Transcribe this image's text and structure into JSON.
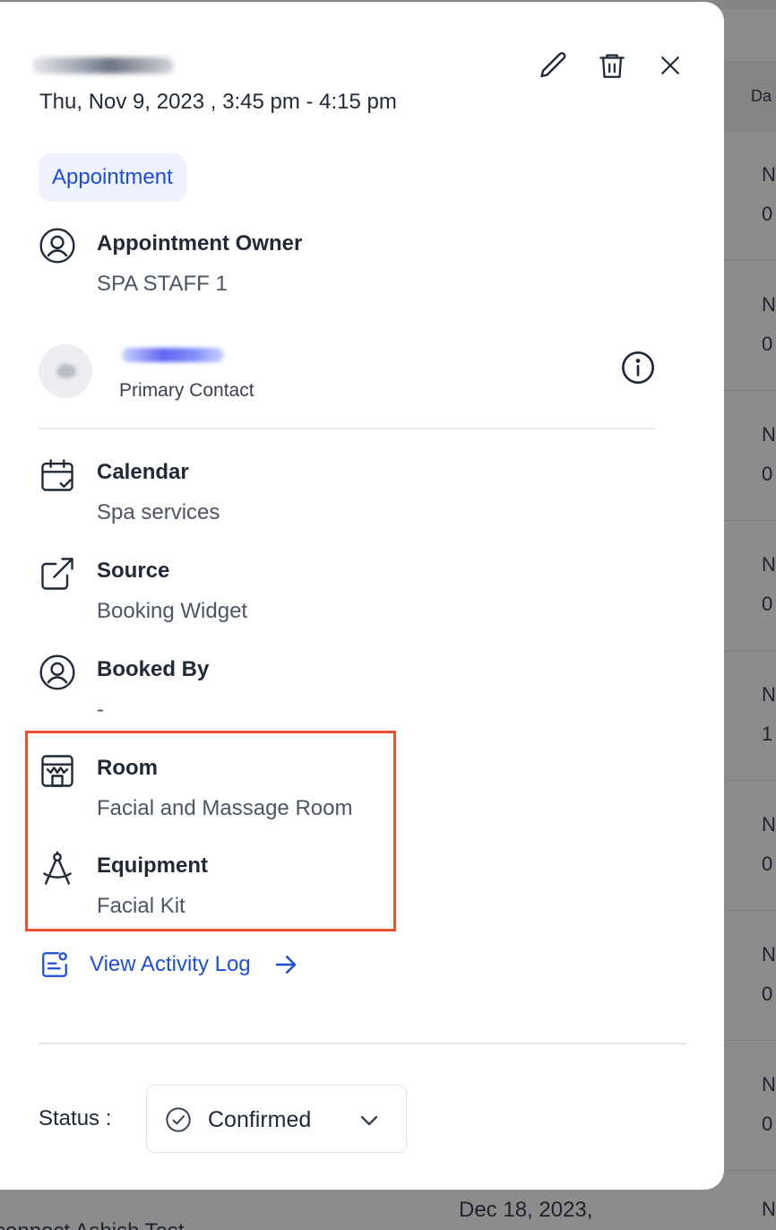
{
  "background_table": {
    "header": "Da",
    "rows": [
      {
        "l1": "N",
        "l2": "0"
      },
      {
        "l1": "N",
        "l2": "0"
      },
      {
        "l1": "N",
        "l2": "0"
      },
      {
        "l1": "N",
        "l2": "0"
      },
      {
        "l1": "N",
        "l2": "1"
      },
      {
        "l1": "N",
        "l2": "0"
      },
      {
        "l1": "N",
        "l2": "0"
      },
      {
        "l1": "N",
        "l2": "0"
      }
    ],
    "bottom_date": "Dec 18, 2023,",
    "bottom_name": "connect Ashish Test",
    "bottom_n": "N"
  },
  "appointment": {
    "datetime": "Thu, Nov 9, 2023 , 3:45 pm - 4:15 pm",
    "type_badge": "Appointment",
    "owner_label": "Appointment Owner",
    "owner_value": "SPA STAFF 1",
    "contact_role": "Primary Contact",
    "calendar_label": "Calendar",
    "calendar_value": "Spa services",
    "source_label": "Source",
    "source_value": "Booking Widget",
    "booked_by_label": "Booked By",
    "booked_by_value": "-",
    "room_label": "Room",
    "room_value": "Facial and Massage Room",
    "equipment_label": "Equipment",
    "equipment_value": "Facial Kit",
    "activity_link": "View Activity Log",
    "status_label": "Status :",
    "status_value": "Confirmed"
  },
  "colors": {
    "accent_blue": "#1d4ed8",
    "badge_bg": "#eef2ff",
    "highlight_border": "#e8502e",
    "icon_stroke": "#1f2937"
  },
  "icons": [
    "edit-icon",
    "trash-icon",
    "close-icon",
    "user-circle-icon",
    "info-icon",
    "calendar-check-icon",
    "external-link-icon",
    "room-icon",
    "compass-icon",
    "activity-log-icon",
    "arrow-right-icon",
    "check-circle-icon",
    "chevron-down-icon"
  ]
}
